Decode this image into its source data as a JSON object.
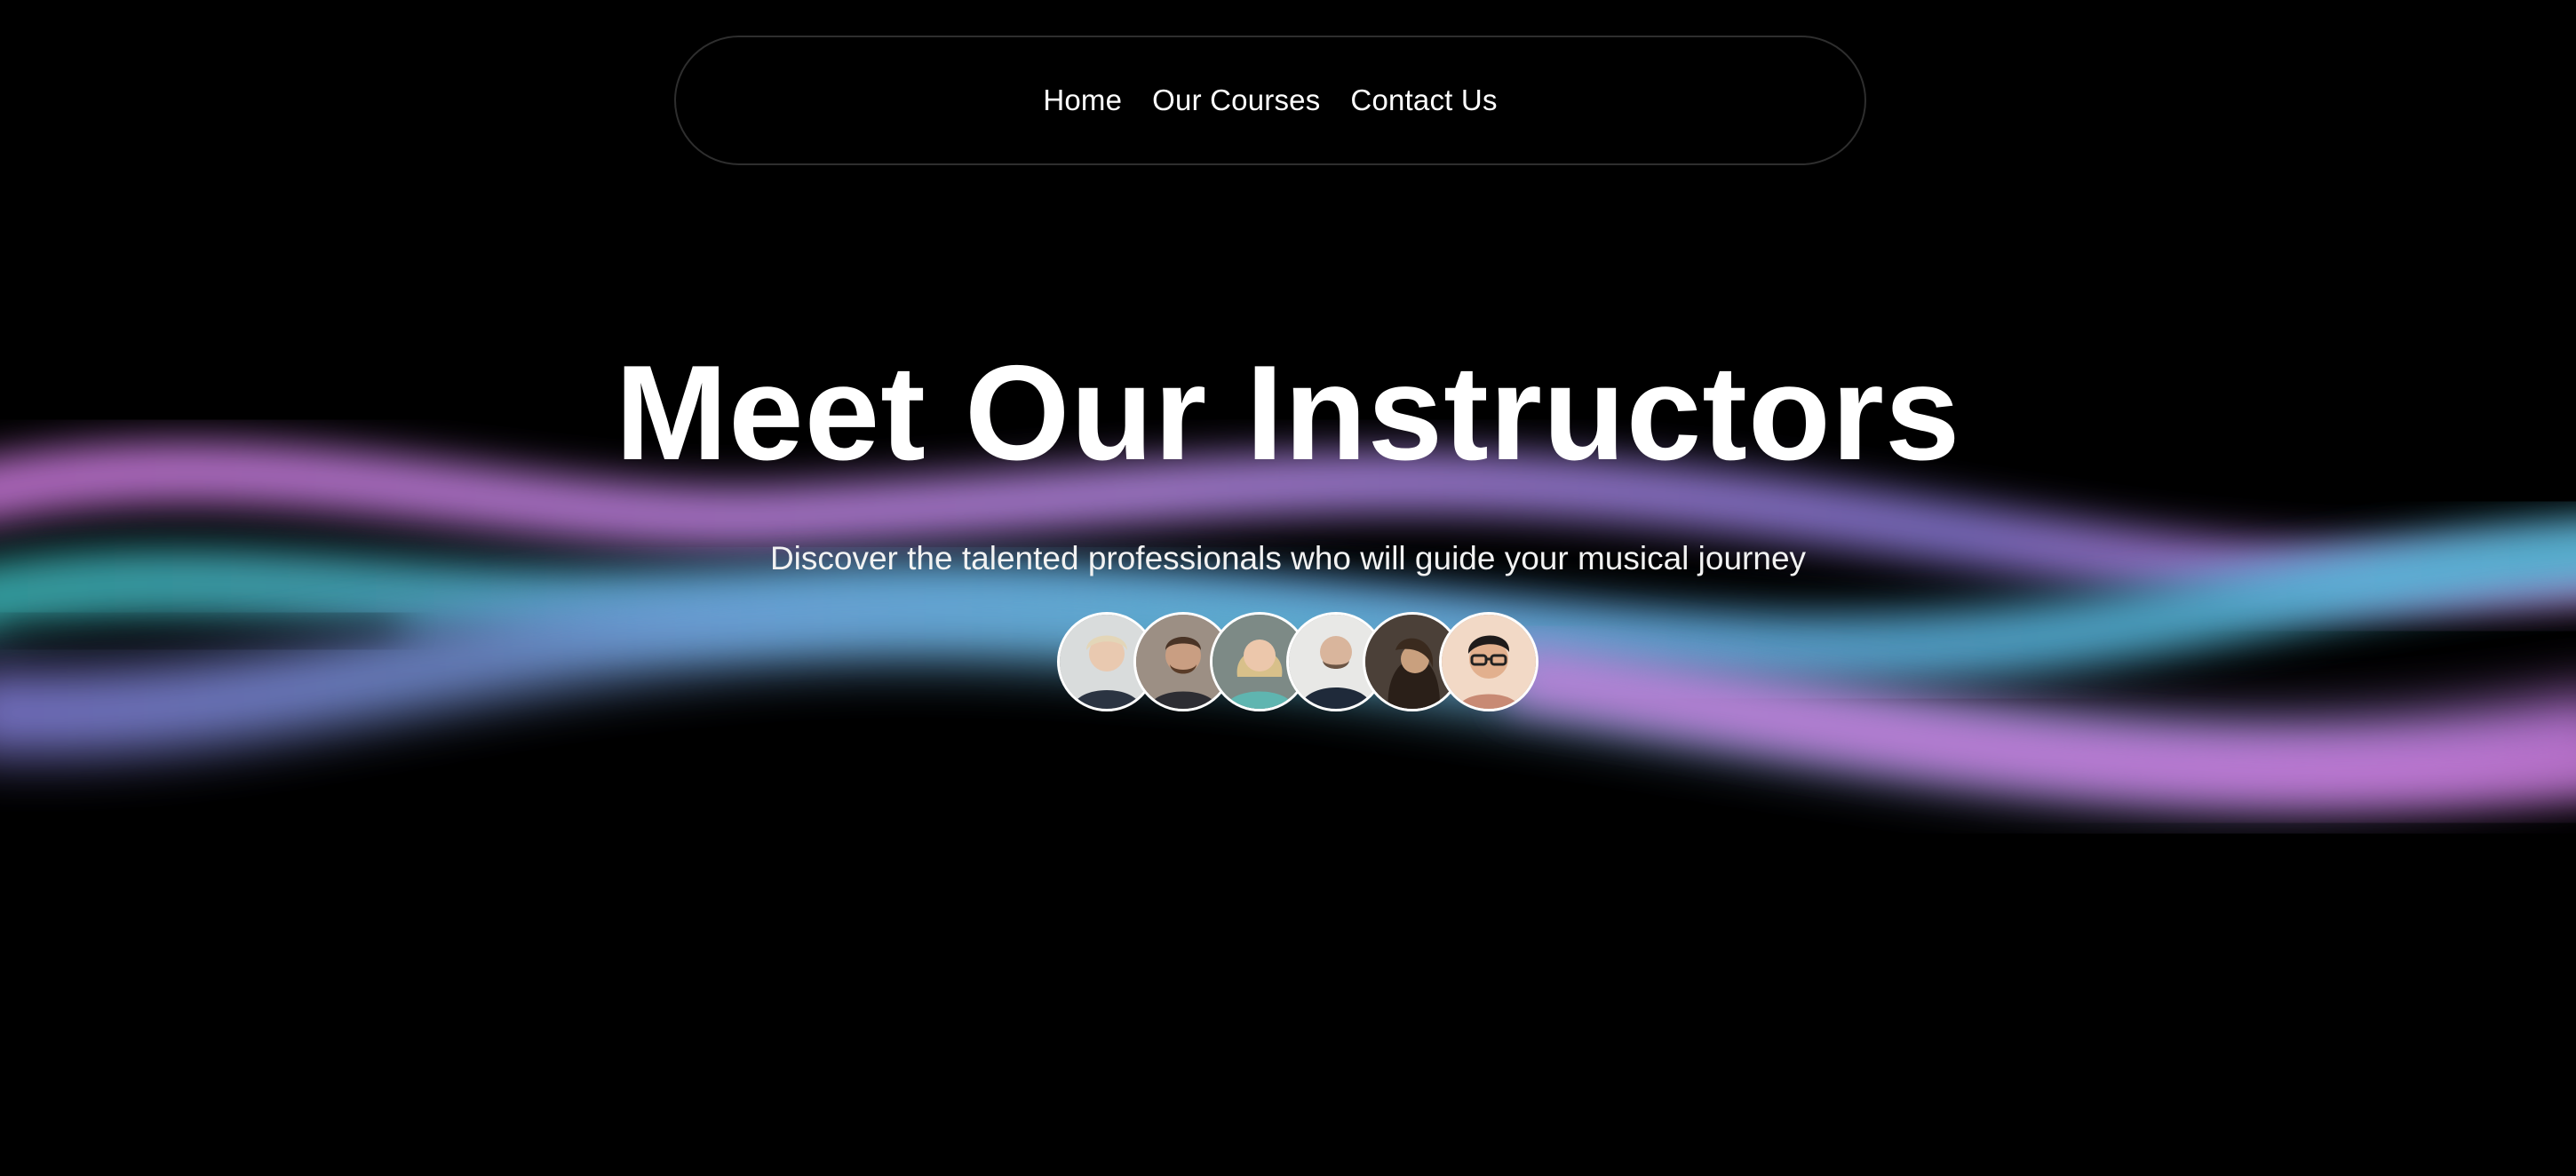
{
  "nav": {
    "items": [
      {
        "label": "Home"
      },
      {
        "label": "Our Courses"
      },
      {
        "label": "Contact Us"
      }
    ]
  },
  "hero": {
    "title": "Meet Our Instructors",
    "subtitle": "Discover the talented professionals who will guide your musical journey"
  },
  "instructors": {
    "count": 6
  },
  "colors": {
    "background": "#000000",
    "wave_pink": "#c77be0",
    "wave_teal": "#4fc3d6",
    "wave_violet": "#8f86e8"
  }
}
